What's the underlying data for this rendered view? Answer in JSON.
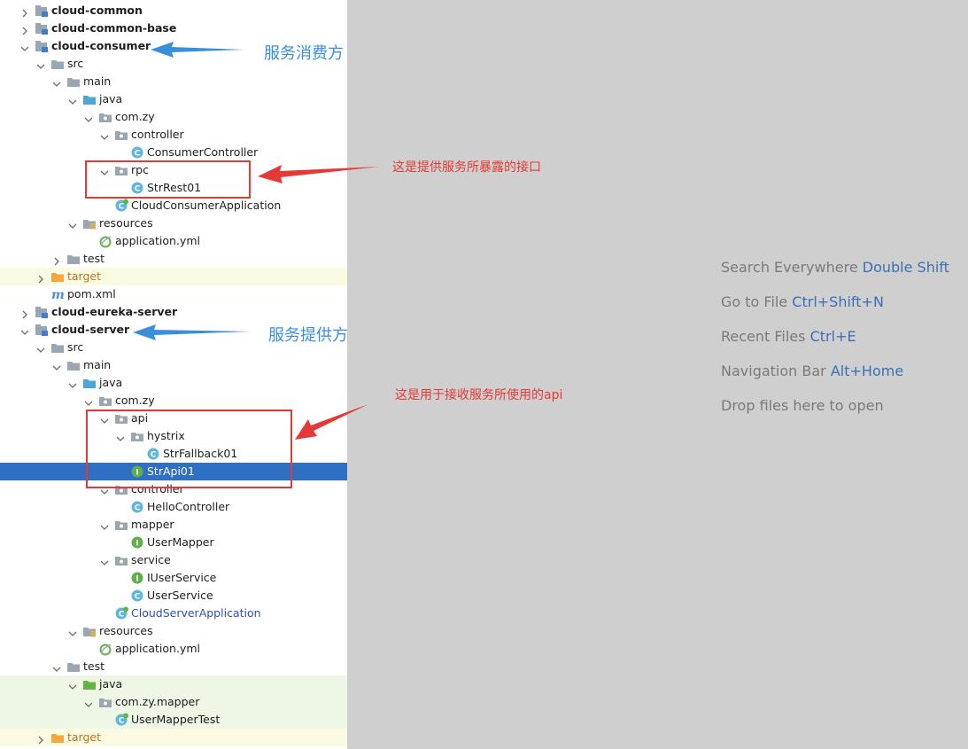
{
  "tree": [
    {
      "label": "cloud-common",
      "depth": 0,
      "chev": "right",
      "icon": "module",
      "bold": true
    },
    {
      "label": "cloud-common-base",
      "depth": 0,
      "chev": "right",
      "icon": "module",
      "bold": true
    },
    {
      "label": "cloud-consumer",
      "depth": 0,
      "chev": "down",
      "icon": "module",
      "bold": true
    },
    {
      "label": "src",
      "depth": 1,
      "chev": "down",
      "icon": "folder-gray"
    },
    {
      "label": "main",
      "depth": 2,
      "chev": "down",
      "icon": "folder-gray"
    },
    {
      "label": "java",
      "depth": 3,
      "chev": "down",
      "icon": "folder-blue"
    },
    {
      "label": "com.zy",
      "depth": 4,
      "chev": "down",
      "icon": "package"
    },
    {
      "label": "controller",
      "depth": 5,
      "chev": "down",
      "icon": "package"
    },
    {
      "label": "ConsumerController",
      "depth": 6,
      "icon": "class"
    },
    {
      "label": "rpc",
      "depth": 5,
      "chev": "down",
      "icon": "package"
    },
    {
      "label": "StrRest01",
      "depth": 6,
      "icon": "class"
    },
    {
      "label": "CloudConsumerApplication",
      "depth": 5,
      "icon": "spring-class"
    },
    {
      "label": "resources",
      "depth": 3,
      "chev": "down",
      "icon": "resources-folder"
    },
    {
      "label": "application.yml",
      "depth": 4,
      "icon": "yml"
    },
    {
      "label": "test",
      "depth": 2,
      "chev": "right",
      "icon": "folder-gray"
    },
    {
      "label": "target",
      "depth": 1,
      "chev": "right",
      "icon": "folder-orange",
      "style": "orange",
      "bg": "yellow"
    },
    {
      "label": "pom.xml",
      "depth": 1,
      "icon": "maven"
    },
    {
      "label": "cloud-eureka-server",
      "depth": 0,
      "chev": "right",
      "icon": "module",
      "bold": true
    },
    {
      "label": "cloud-server",
      "depth": 0,
      "chev": "down",
      "icon": "module",
      "bold": true
    },
    {
      "label": "src",
      "depth": 1,
      "chev": "down",
      "icon": "folder-gray"
    },
    {
      "label": "main",
      "depth": 2,
      "chev": "down",
      "icon": "folder-gray"
    },
    {
      "label": "java",
      "depth": 3,
      "chev": "down",
      "icon": "folder-blue"
    },
    {
      "label": "com.zy",
      "depth": 4,
      "chev": "down",
      "icon": "package"
    },
    {
      "label": "api",
      "depth": 5,
      "chev": "down",
      "icon": "package"
    },
    {
      "label": "hystrix",
      "depth": 6,
      "chev": "down",
      "icon": "package"
    },
    {
      "label": "StrFallback01",
      "depth": 7,
      "icon": "class"
    },
    {
      "label": "StrApi01",
      "depth": 6,
      "icon": "interface",
      "selected": true
    },
    {
      "label": "controller",
      "depth": 5,
      "chev": "down",
      "icon": "package"
    },
    {
      "label": "HelloController",
      "depth": 6,
      "icon": "class"
    },
    {
      "label": "mapper",
      "depth": 5,
      "chev": "down",
      "icon": "package"
    },
    {
      "label": "UserMapper",
      "depth": 6,
      "icon": "interface"
    },
    {
      "label": "service",
      "depth": 5,
      "chev": "down",
      "icon": "package"
    },
    {
      "label": "IUserService",
      "depth": 6,
      "icon": "interface"
    },
    {
      "label": "UserService",
      "depth": 6,
      "icon": "class"
    },
    {
      "label": "CloudServerApplication",
      "depth": 5,
      "icon": "spring-class",
      "style": "blue"
    },
    {
      "label": "resources",
      "depth": 3,
      "chev": "down",
      "icon": "resources-folder"
    },
    {
      "label": "application.yml",
      "depth": 4,
      "icon": "yml"
    },
    {
      "label": "test",
      "depth": 2,
      "chev": "down",
      "icon": "folder-gray"
    },
    {
      "label": "java",
      "depth": 3,
      "chev": "down",
      "icon": "folder-green",
      "bg": "green"
    },
    {
      "label": "com.zy.mapper",
      "depth": 4,
      "chev": "down",
      "icon": "package",
      "bg": "green"
    },
    {
      "label": "UserMapperTest",
      "depth": 5,
      "icon": "spring-class",
      "bg": "green"
    },
    {
      "label": "target",
      "depth": 1,
      "chev": "right",
      "icon": "folder-orange",
      "style": "orange",
      "bg": "yellow"
    }
  ],
  "hints": [
    {
      "text": "Search Everywhere",
      "key": "Double Shift"
    },
    {
      "text": "Go to File",
      "key": "Ctrl+Shift+N"
    },
    {
      "text": "Recent Files",
      "key": "Ctrl+E"
    },
    {
      "text": "Navigation Bar",
      "key": "Alt+Home"
    },
    {
      "text": "Drop files here to open",
      "key": ""
    }
  ],
  "annotations": {
    "consumer": "服务消费方",
    "rpc_note": "这是提供服务所暴露的接口",
    "server": "服务提供方",
    "api_note": "这是用于接收服务所使用的api"
  },
  "colors": {
    "selection": "#2f6fc4",
    "editor_bg": "#cfcfcf",
    "annotation_blue": "#3a8fdc",
    "annotation_red": "#e53935"
  }
}
